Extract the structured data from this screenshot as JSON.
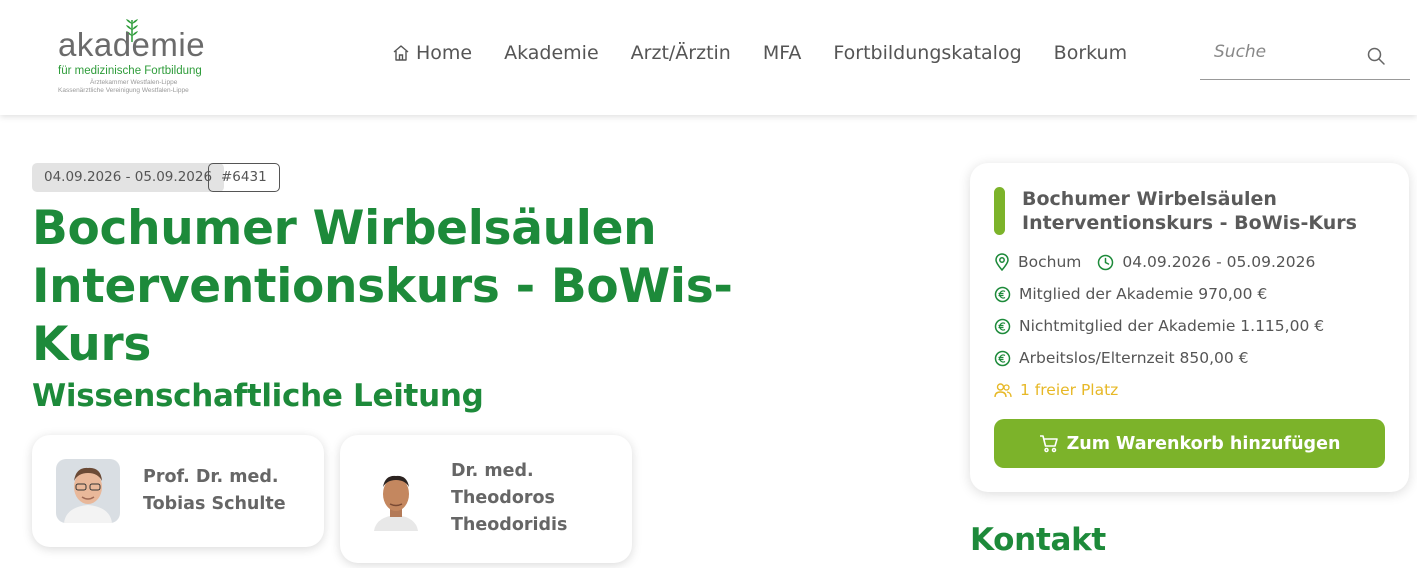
{
  "header": {
    "logo": {
      "wordmark": "akademie",
      "subtitle": "für medizinische Fortbildung",
      "line1": "Ärztekammer Westfalen-Lippe",
      "line2": "Kassenärztliche Vereinigung Westfalen-Lippe"
    },
    "nav": [
      {
        "label": "Home",
        "icon": "home-icon"
      },
      {
        "label": "Akademie"
      },
      {
        "label": "Arzt/Ärztin"
      },
      {
        "label": "MFA"
      },
      {
        "label": "Fortbildungskatalog"
      },
      {
        "label": "Borkum"
      }
    ],
    "search": {
      "placeholder": "Suche",
      "icon": "search-icon"
    }
  },
  "course": {
    "date_badge": "04.09.2026 - 05.09.2026",
    "id_badge": "#6431",
    "title": "Bochumer Wirbelsäulen Interventionskurs - BoWis-Kurs"
  },
  "leadership": {
    "heading": "Wissenschaftliche Leitung",
    "people": [
      {
        "name": "Prof. Dr. med. Tobias Schulte",
        "line1": "Prof. Dr. med.",
        "line2": "Tobias Schulte"
      },
      {
        "name": "Dr. med. Theodoros Theodoridis",
        "line1": "Dr. med.",
        "line2": "Theodoros",
        "line3": "Theodoridis"
      }
    ]
  },
  "info_card": {
    "title": "Bochumer Wirbelsäulen Interventionskurs - BoWis-Kurs",
    "location": "Bochum",
    "dates": "04.09.2026 - 05.09.2026",
    "prices": [
      "Mitglied der Akademie 970,00 €",
      "Nichtmitglied der Akademie 1.115,00 €",
      "Arbeitslos/Elternzeit 850,00 €"
    ],
    "places": "1 freier Platz",
    "cart_button": "Zum Warenkorb hinzufügen"
  },
  "contact": {
    "heading": "Kontakt"
  },
  "colors": {
    "brand_green": "#1d8a3a",
    "accent_green": "#7cb32a",
    "availability_yellow": "#e7b826"
  }
}
